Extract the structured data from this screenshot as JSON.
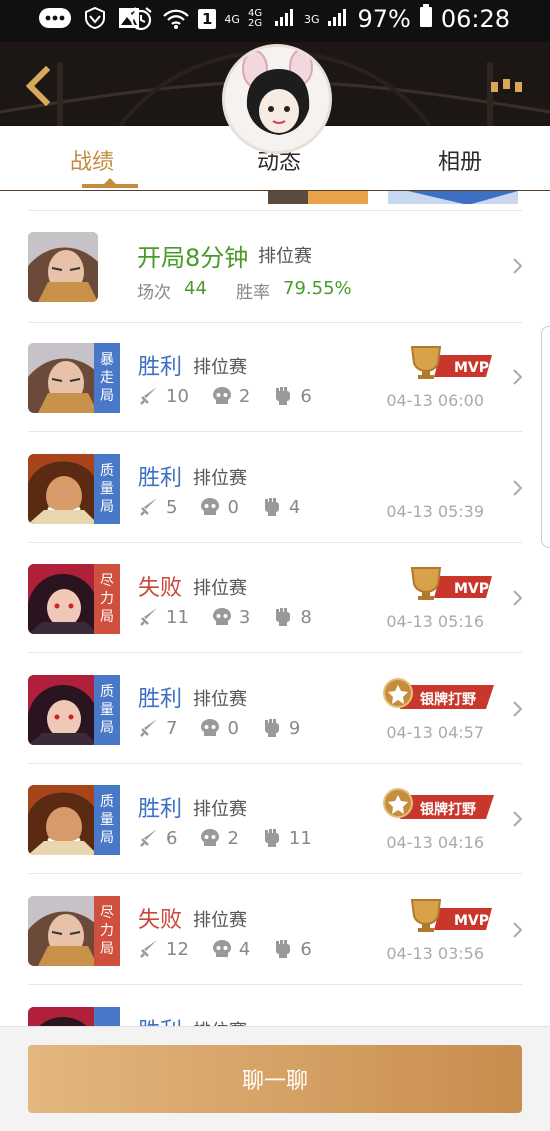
{
  "status_bar": {
    "net_4g": "4G",
    "net_4g_2g": "4G 2G",
    "net_3g": "3G",
    "sim_badge": "1",
    "battery": "97%",
    "time": "06:28",
    "icons": [
      "message-icon",
      "shield-icon",
      "image-icon",
      "alarm-icon",
      "wifi-icon",
      "signal-icon",
      "battery-icon"
    ]
  },
  "tabs": [
    {
      "label": "战绩"
    },
    {
      "label": "动态"
    },
    {
      "label": "相册"
    }
  ],
  "summary": {
    "title": "开局8分钟",
    "type": "排位赛",
    "matches_label": "场次",
    "matches": "44",
    "winrate_label": "胜率",
    "winrate": "79.55%"
  },
  "matches": [
    {
      "result": "胜利",
      "type": "排位赛",
      "kills": "10",
      "deaths": "2",
      "assists": "6",
      "time": "04-13 06:00",
      "mode": "暴走局",
      "badge": "MVP"
    },
    {
      "result": "胜利",
      "type": "排位赛",
      "kills": "5",
      "deaths": "0",
      "assists": "4",
      "time": "04-13 05:39",
      "mode": "质量局",
      "badge": ""
    },
    {
      "result": "失败",
      "type": "排位赛",
      "kills": "11",
      "deaths": "3",
      "assists": "8",
      "time": "04-13 05:16",
      "mode": "尽力局",
      "badge": "MVP"
    },
    {
      "result": "胜利",
      "type": "排位赛",
      "kills": "7",
      "deaths": "0",
      "assists": "9",
      "time": "04-13 04:57",
      "mode": "质量局",
      "badge": "银牌打野"
    },
    {
      "result": "胜利",
      "type": "排位赛",
      "kills": "6",
      "deaths": "2",
      "assists": "11",
      "time": "04-13 04:16",
      "mode": "质量局",
      "badge": "银牌打野"
    },
    {
      "result": "失败",
      "type": "排位赛",
      "kills": "12",
      "deaths": "4",
      "assists": "6",
      "time": "04-13 03:56",
      "mode": "尽力局",
      "badge": "MVP"
    },
    {
      "result": "胜利",
      "type": "排位赛",
      "mode": "质"
    }
  ],
  "bottom": {
    "chat_label": "聊一聊"
  },
  "colors": {
    "accent": "#c48a40",
    "win": "#3d6fc2",
    "loss": "#c9473a",
    "summary_green": "#4a9a2a",
    "tag_blue": "#4a78c8",
    "tag_red": "#d0503f"
  }
}
